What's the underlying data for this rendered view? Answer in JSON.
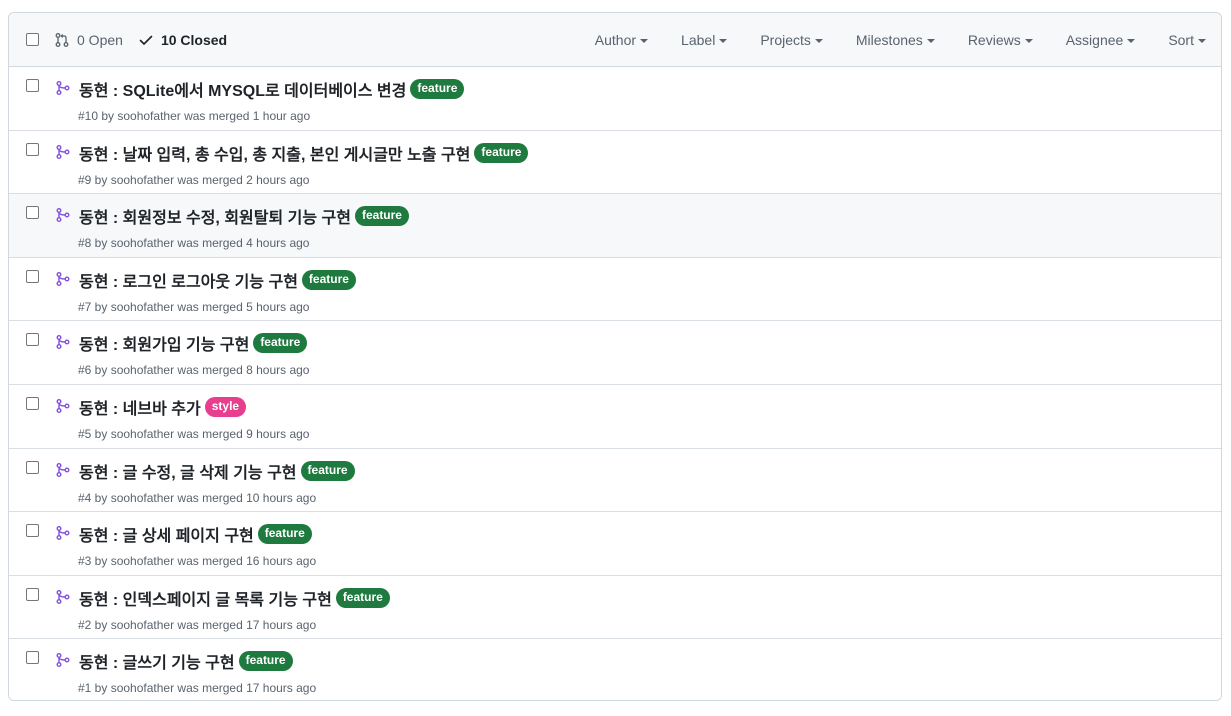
{
  "header": {
    "open_label": "0 Open",
    "closed_label": "10 Closed",
    "filters": [
      "Author",
      "Label",
      "Projects",
      "Milestones",
      "Reviews",
      "Assignee",
      "Sort"
    ]
  },
  "colors": {
    "feature": "#1f7a3f",
    "style": "#e73e8f",
    "merged_icon": "#8250df"
  },
  "pulls": [
    {
      "title": "동현 : SQLite에서 MYSQL로 데이터베이스 변경",
      "label": "feature",
      "meta": "#10 by soohofather was merged 1 hour ago"
    },
    {
      "title": "동현 : 날짜 입력, 총 수입, 총 지출, 본인 게시글만 노출 구현",
      "label": "feature",
      "meta": "#9 by soohofather was merged 2 hours ago"
    },
    {
      "title": "동현 : 회원정보 수정, 회원탈퇴 기능 구현",
      "label": "feature",
      "meta": "#8 by soohofather was merged 4 hours ago"
    },
    {
      "title": "동현 : 로그인 로그아웃 기능 구현",
      "label": "feature",
      "meta": "#7 by soohofather was merged 5 hours ago"
    },
    {
      "title": "동현 : 회원가입 기능 구현",
      "label": "feature",
      "meta": "#6 by soohofather was merged 8 hours ago"
    },
    {
      "title": "동현 : 네브바 추가",
      "label": "style",
      "meta": "#5 by soohofather was merged 9 hours ago"
    },
    {
      "title": "동현 : 글 수정, 글 삭제 기능 구현",
      "label": "feature",
      "meta": "#4 by soohofather was merged 10 hours ago"
    },
    {
      "title": "동현 : 글 상세 페이지 구현",
      "label": "feature",
      "meta": "#3 by soohofather was merged 16 hours ago"
    },
    {
      "title": "동현 : 인덱스페이지 글 목록 기능 구현",
      "label": "feature",
      "meta": "#2 by soohofather was merged 17 hours ago"
    },
    {
      "title": "동현 : 글쓰기 기능 구현",
      "label": "feature",
      "meta": "#1 by soohofather was merged 17 hours ago"
    }
  ]
}
